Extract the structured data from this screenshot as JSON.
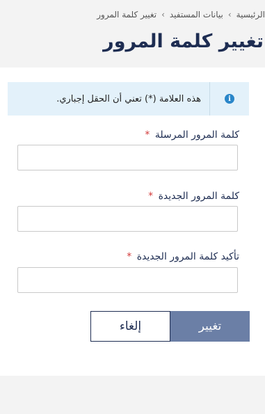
{
  "breadcrumb": {
    "items": [
      "الرئيسية",
      "بيانات المستفيد",
      "تغيير كلمة المرور"
    ],
    "separator": "›"
  },
  "page": {
    "title": "تغيير كلمة المرور"
  },
  "info": {
    "icon": "info-icon",
    "icon_glyph": "i",
    "text": "هذه العلامة (*) تعني أن الحقل إجباري."
  },
  "form": {
    "required_mark": "*",
    "fields": [
      {
        "label": "كلمة المرور المرسلة",
        "value": "",
        "placeholder": ""
      },
      {
        "label": "كلمة المرور الجديدة",
        "value": "",
        "placeholder": ""
      },
      {
        "label": "تأكيد كلمة المرور الجديدة",
        "value": "",
        "placeholder": ""
      }
    ]
  },
  "actions": {
    "change_label": "تغيير",
    "cancel_label": "إلغاء"
  },
  "colors": {
    "title": "#1e2d52",
    "primary_button": "#6b7fa6",
    "info_background": "#e3f1fa",
    "info_icon": "#2a86c9",
    "required": "#d23b3b"
  }
}
